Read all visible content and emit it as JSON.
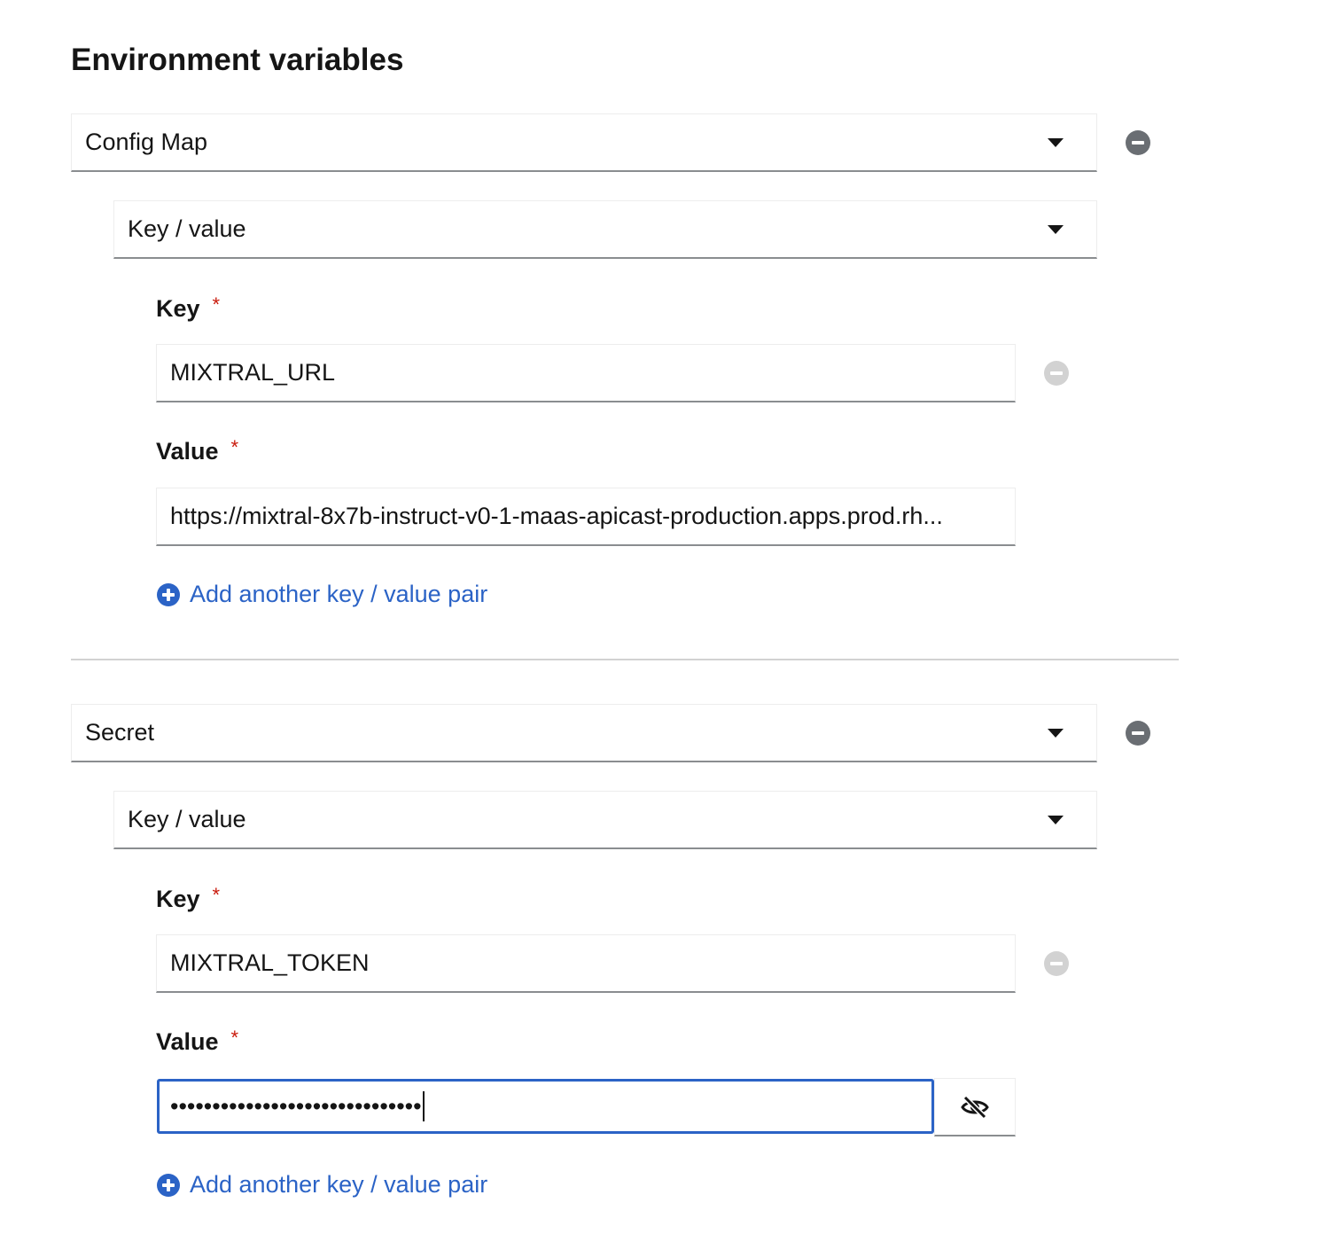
{
  "page": {
    "title": "Environment variables"
  },
  "env_groups": [
    {
      "source_type": "Config Map",
      "mode": "Key / value",
      "key_label": "Key",
      "key_value": "MIXTRAL_URL",
      "value_label": "Value",
      "value_value": "https://mixtral-8x7b-instruct-v0-1-maas-apicast-production.apps.prod.rh...",
      "required_marker": "*",
      "add_pair_label": "Add another key / value pair"
    },
    {
      "source_type": "Secret",
      "mode": "Key / value",
      "key_label": "Key",
      "key_value": "MIXTRAL_TOKEN",
      "value_label": "Value",
      "value_masked": "••••••••••••••••••••••••••••••",
      "required_marker": "*",
      "add_pair_label": "Add another key / value pair"
    }
  ],
  "icons": {
    "remove_group": "minus-circle-icon",
    "remove_pair": "minus-circle-disabled-icon",
    "add_pair": "plus-circle-icon",
    "toggle_visibility": "eye-slash-icon",
    "dropdown": "caret-down-icon"
  },
  "colors": {
    "link": "#2b63c6",
    "required": "#c9190b",
    "focus_border": "#2b63c6",
    "remove_icon": "#6a6e73",
    "remove_icon_disabled": "#d2d2d2"
  }
}
